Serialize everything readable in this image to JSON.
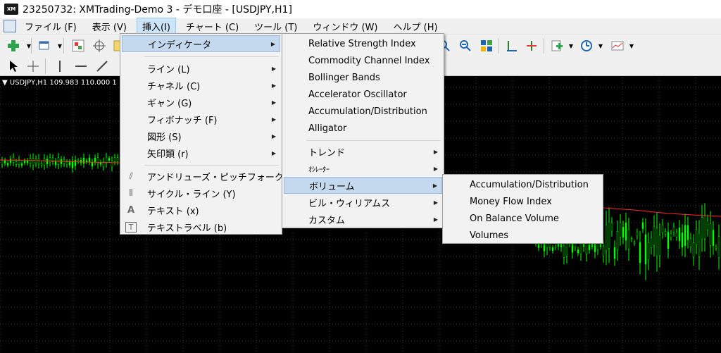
{
  "window": {
    "logo_text": "XM",
    "title": "23250732: XMTrading-Demo 3 - デモ口座 - [USDJPY,H1]"
  },
  "menubar": {
    "items": [
      "ファイル (F)",
      "表示 (V)",
      "挿入(I)",
      "チャート (C)",
      "ツール (T)",
      "ウィンドウ (W)",
      "ヘルプ (H)"
    ],
    "active": "挿入(I)"
  },
  "chart": {
    "symbol_label": "▼ USDJPY,H1  109.983 110.000 1"
  },
  "insert_menu": {
    "items": [
      {
        "label": "インディケータ",
        "submenu": true,
        "highlighted": true
      },
      {
        "label": "ライン (L)",
        "submenu": true
      },
      {
        "label": "チャネル (C)",
        "submenu": true
      },
      {
        "label": "ギャン (G)",
        "submenu": true
      },
      {
        "label": "フィボナッチ (F)",
        "submenu": true
      },
      {
        "label": "図形 (S)",
        "submenu": true
      },
      {
        "label": "矢印類 (r)",
        "submenu": true
      },
      {
        "label": "アンドリューズ・ピッチフォーク (A)",
        "icon": "pitchfork-icon"
      },
      {
        "label": "サイクル・ライン (Y)",
        "icon": "cycle-lines-icon"
      },
      {
        "label": "テキスト (x)",
        "icon": "text-icon",
        "icon_char": "A"
      },
      {
        "label": "テキストラベル (b)",
        "icon": "text-label-icon",
        "icon_char": "T"
      }
    ]
  },
  "indicator_menu": {
    "items": [
      {
        "label": "Relative Strength Index"
      },
      {
        "label": "Commodity Channel Index"
      },
      {
        "label": "Bollinger Bands"
      },
      {
        "label": "Accelerator Oscillator"
      },
      {
        "label": "Accumulation/Distribution"
      },
      {
        "label": "Alligator"
      },
      {
        "label": "トレンド",
        "submenu": true
      },
      {
        "label": "ｵｼﾚｰﾀｰ",
        "submenu": true
      },
      {
        "label": "ボリューム",
        "submenu": true,
        "highlighted": true
      },
      {
        "label": "ビル・ウィリアムス",
        "submenu": true
      },
      {
        "label": "カスタム",
        "submenu": true
      }
    ]
  },
  "volume_menu": {
    "items": [
      {
        "label": "Accumulation/Distribution"
      },
      {
        "label": "Money Flow Index"
      },
      {
        "label": "On Balance Volume"
      },
      {
        "label": "Volumes"
      }
    ]
  },
  "colors": {
    "chart_bg": "#000000",
    "bull_candle": "#00ff00",
    "moving_average": "#ff2a2a",
    "grid": "#3a3a3a",
    "highlight": "#c4d9ee"
  }
}
